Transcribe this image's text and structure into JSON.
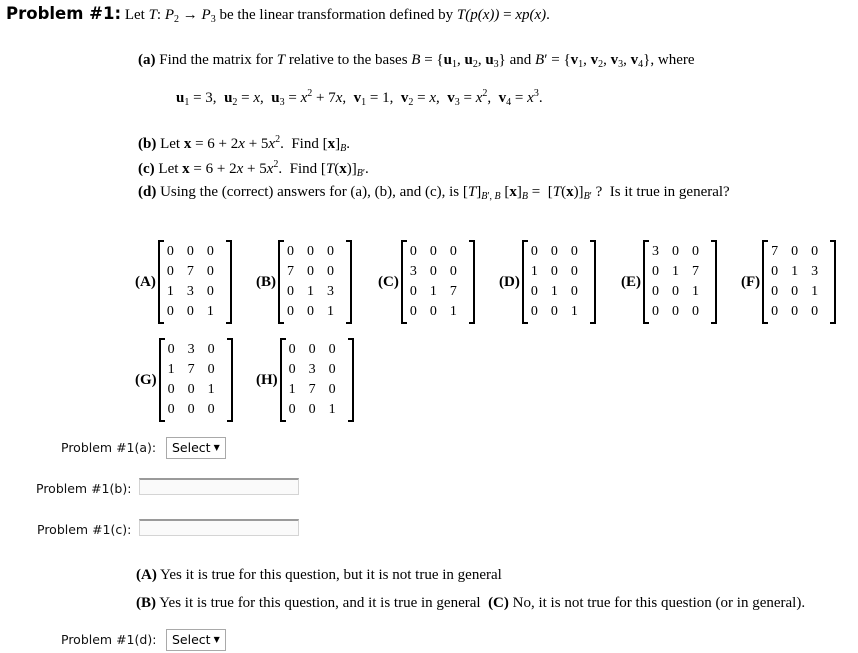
{
  "problem": {
    "heading": "Problem #1:",
    "intro": {
      "let": "Let",
      "T": "T",
      "colon": ":",
      "P": "P",
      "from_sub": "2",
      "arrow": "→",
      "to_sub": "3",
      "rest": "be the linear transformation defined by",
      "definition_lhs": "T(p(x))",
      "equals": "=",
      "definition_rhs": "xp(x)",
      "period": "."
    }
  },
  "parts": {
    "a": {
      "label": "(a)",
      "text_before_T": "Find the matrix for",
      "T": "T",
      "text_after_T": "relative to the bases",
      "B_set": "B = {u1, u2, u3}",
      "and": "and",
      "Bp_set": "B′ = {v1, v2, v3, v4}",
      "where": ", where",
      "basis_line": "u1 = 3, u2 = x, u3 = x^2 + 7x, v1 = 1, v2 = x, v3 = x^2, v4 = x^3."
    },
    "b": {
      "label": "(b)",
      "text": "Let x = 6 + 2x + 5x^2. Find [x]_B."
    },
    "c": {
      "label": "(c)",
      "text": "Let x = 6 + 2x + 5x^2. Find [T(x)]_B′."
    },
    "d": {
      "label": "(d)",
      "text": "Using the (correct) answers for (a), (b), and (c), is [T]_B′,B [x]_B = [T(x)]_B′ ? Is it true in general?"
    }
  },
  "matrices": [
    {
      "label": "(A)",
      "rows": [
        [
          "0",
          "0",
          "0"
        ],
        [
          "0",
          "7",
          "0"
        ],
        [
          "1",
          "3",
          "0"
        ],
        [
          "0",
          "0",
          "1"
        ]
      ]
    },
    {
      "label": "(B)",
      "rows": [
        [
          "0",
          "0",
          "0"
        ],
        [
          "7",
          "0",
          "0"
        ],
        [
          "0",
          "1",
          "3"
        ],
        [
          "0",
          "0",
          "1"
        ]
      ]
    },
    {
      "label": "(C)",
      "rows": [
        [
          "0",
          "0",
          "0"
        ],
        [
          "3",
          "0",
          "0"
        ],
        [
          "0",
          "1",
          "7"
        ],
        [
          "0",
          "0",
          "1"
        ]
      ]
    },
    {
      "label": "(D)",
      "rows": [
        [
          "0",
          "0",
          "0"
        ],
        [
          "1",
          "0",
          "0"
        ],
        [
          "0",
          "1",
          "0"
        ],
        [
          "0",
          "0",
          "1"
        ]
      ]
    },
    {
      "label": "(E)",
      "rows": [
        [
          "3",
          "0",
          "0"
        ],
        [
          "0",
          "1",
          "7"
        ],
        [
          "0",
          "0",
          "1"
        ],
        [
          "0",
          "0",
          "0"
        ]
      ]
    },
    {
      "label": "(F)",
      "rows": [
        [
          "7",
          "0",
          "0"
        ],
        [
          "0",
          "1",
          "3"
        ],
        [
          "0",
          "0",
          "1"
        ],
        [
          "0",
          "0",
          "0"
        ]
      ]
    },
    {
      "label": "(G)",
      "rows": [
        [
          "0",
          "3",
          "0"
        ],
        [
          "1",
          "7",
          "0"
        ],
        [
          "0",
          "0",
          "1"
        ],
        [
          "0",
          "0",
          "0"
        ]
      ]
    },
    {
      "label": "(H)",
      "rows": [
        [
          "0",
          "0",
          "0"
        ],
        [
          "0",
          "3",
          "0"
        ],
        [
          "1",
          "7",
          "0"
        ],
        [
          "0",
          "0",
          "1"
        ]
      ]
    }
  ],
  "answers": {
    "a": {
      "label": "Problem #1(a):",
      "select_value": "Select",
      "arrow_icon": "▼"
    },
    "b": {
      "label": "Problem #1(b):",
      "value": "",
      "placeholder": ""
    },
    "c": {
      "label": "Problem #1(c):",
      "value": "",
      "placeholder": ""
    },
    "d": {
      "label": "Problem #1(d):",
      "select_value": "Select",
      "arrow_icon": "▼"
    }
  },
  "choices_d": [
    {
      "label": "(A)",
      "text": "Yes it is true for this question, but it is not true in general"
    },
    {
      "label": "(B)",
      "text": "Yes it is true for this question, and it is true in general"
    },
    {
      "label": "(C)",
      "text": "No, it is not true for this question (or in general)."
    }
  ]
}
